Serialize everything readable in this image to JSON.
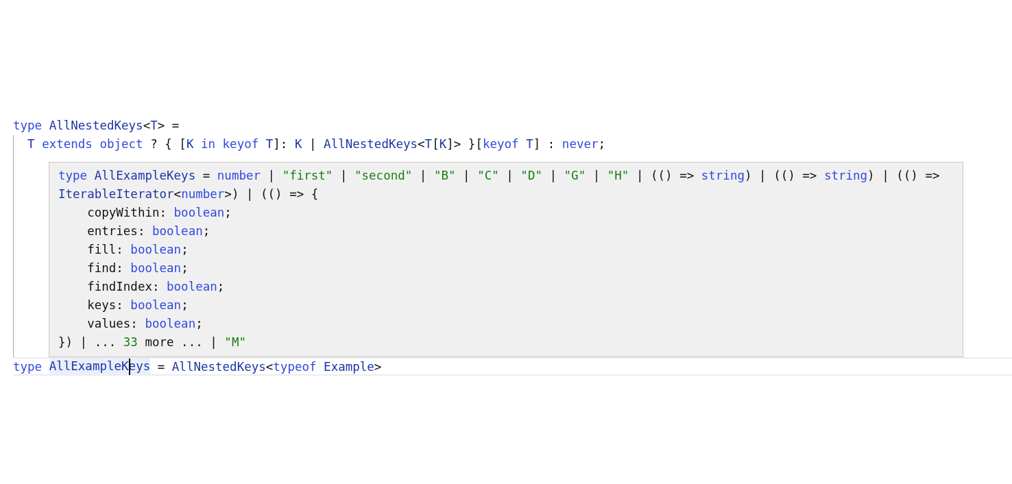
{
  "editor": {
    "code_lines": [
      {
        "tokens": [
          {
            "text": "type ",
            "kind": "keyword"
          },
          {
            "text": "AllNestedKeys",
            "kind": "identifier"
          },
          {
            "text": "<",
            "kind": "plain"
          },
          {
            "text": "T",
            "kind": "identifier"
          },
          {
            "text": "> =",
            "kind": "plain"
          }
        ]
      },
      {
        "tokens": [
          {
            "text": "  T",
            "kind": "identifier"
          },
          {
            "text": " extends object",
            "kind": "keyword"
          },
          {
            "text": " ? { [",
            "kind": "plain"
          },
          {
            "text": "K",
            "kind": "identifier"
          },
          {
            "text": " in keyof ",
            "kind": "keyword"
          },
          {
            "text": "T",
            "kind": "identifier"
          },
          {
            "text": "]: ",
            "kind": "plain"
          },
          {
            "text": "K",
            "kind": "identifier"
          },
          {
            "text": " | ",
            "kind": "plain"
          },
          {
            "text": "AllNestedKeys",
            "kind": "identifier"
          },
          {
            "text": "<",
            "kind": "plain"
          },
          {
            "text": "T",
            "kind": "identifier"
          },
          {
            "text": "[",
            "kind": "plain"
          },
          {
            "text": "K",
            "kind": "identifier"
          },
          {
            "text": "]> }[",
            "kind": "plain"
          },
          {
            "text": "keyof ",
            "kind": "keyword"
          },
          {
            "text": "T",
            "kind": "identifier"
          },
          {
            "text": "] : ",
            "kind": "plain"
          },
          {
            "text": "never",
            "kind": "keyword"
          },
          {
            "text": ";",
            "kind": "plain"
          }
        ]
      }
    ],
    "hover_tooltip": {
      "lines": [
        {
          "tokens": [
            {
              "text": "type ",
              "kind": "keyword"
            },
            {
              "text": "AllExampleKeys",
              "kind": "identifier"
            },
            {
              "text": " = ",
              "kind": "plain"
            },
            {
              "text": "number",
              "kind": "keyword"
            },
            {
              "text": " | ",
              "kind": "plain"
            },
            {
              "text": "\"first\"",
              "kind": "literal"
            },
            {
              "text": " | ",
              "kind": "plain"
            },
            {
              "text": "\"second\"",
              "kind": "literal"
            },
            {
              "text": " | ",
              "kind": "plain"
            },
            {
              "text": "\"B\"",
              "kind": "literal"
            },
            {
              "text": " | ",
              "kind": "plain"
            },
            {
              "text": "\"C\"",
              "kind": "literal"
            },
            {
              "text": " | ",
              "kind": "plain"
            },
            {
              "text": "\"D\"",
              "kind": "literal"
            },
            {
              "text": " | ",
              "kind": "plain"
            },
            {
              "text": "\"G\"",
              "kind": "literal"
            },
            {
              "text": " | ",
              "kind": "plain"
            },
            {
              "text": "\"H\"",
              "kind": "literal"
            },
            {
              "text": " | (() => ",
              "kind": "plain"
            },
            {
              "text": "string",
              "kind": "keyword"
            },
            {
              "text": ") | (() => ",
              "kind": "plain"
            },
            {
              "text": "string",
              "kind": "keyword"
            },
            {
              "text": ") | (() =>",
              "kind": "plain"
            }
          ]
        },
        {
          "tokens": [
            {
              "text": "IterableIterator",
              "kind": "identifier"
            },
            {
              "text": "<",
              "kind": "plain"
            },
            {
              "text": "number",
              "kind": "keyword"
            },
            {
              "text": ">) | (() => {",
              "kind": "plain"
            }
          ]
        },
        {
          "tokens": [
            {
              "text": "    copyWithin: ",
              "kind": "plain"
            },
            {
              "text": "boolean",
              "kind": "keyword"
            },
            {
              "text": ";",
              "kind": "plain"
            }
          ]
        },
        {
          "tokens": [
            {
              "text": "    entries: ",
              "kind": "plain"
            },
            {
              "text": "boolean",
              "kind": "keyword"
            },
            {
              "text": ";",
              "kind": "plain"
            }
          ]
        },
        {
          "tokens": [
            {
              "text": "    fill: ",
              "kind": "plain"
            },
            {
              "text": "boolean",
              "kind": "keyword"
            },
            {
              "text": ";",
              "kind": "plain"
            }
          ]
        },
        {
          "tokens": [
            {
              "text": "    find: ",
              "kind": "plain"
            },
            {
              "text": "boolean",
              "kind": "keyword"
            },
            {
              "text": ";",
              "kind": "plain"
            }
          ]
        },
        {
          "tokens": [
            {
              "text": "    findIndex: ",
              "kind": "plain"
            },
            {
              "text": "boolean",
              "kind": "keyword"
            },
            {
              "text": ";",
              "kind": "plain"
            }
          ]
        },
        {
          "tokens": [
            {
              "text": "    keys: ",
              "kind": "plain"
            },
            {
              "text": "boolean",
              "kind": "keyword"
            },
            {
              "text": ";",
              "kind": "plain"
            }
          ]
        },
        {
          "tokens": [
            {
              "text": "    values: ",
              "kind": "plain"
            },
            {
              "text": "boolean",
              "kind": "keyword"
            },
            {
              "text": ";",
              "kind": "plain"
            }
          ]
        },
        {
          "tokens": [
            {
              "text": "}) | ... ",
              "kind": "plain"
            },
            {
              "text": "33",
              "kind": "literal"
            },
            {
              "text": " more ... | ",
              "kind": "plain"
            },
            {
              "text": "\"M\"",
              "kind": "literal"
            }
          ]
        }
      ]
    },
    "active_line": {
      "tokens_before": [
        {
          "text": "type ",
          "kind": "keyword"
        }
      ],
      "word": {
        "kind": "identifier",
        "highlighted": true,
        "cursor_visible": true,
        "text_before_cursor": "AllExampleK",
        "text_after_cursor": "eys"
      },
      "tokens_after": [
        {
          "text": " = ",
          "kind": "plain"
        },
        {
          "text": "AllNestedKeys",
          "kind": "identifier"
        },
        {
          "text": "<",
          "kind": "plain"
        },
        {
          "text": "typeof ",
          "kind": "keyword"
        },
        {
          "text": "Example",
          "kind": "identifier"
        },
        {
          "text": ">",
          "kind": "plain"
        }
      ]
    }
  }
}
